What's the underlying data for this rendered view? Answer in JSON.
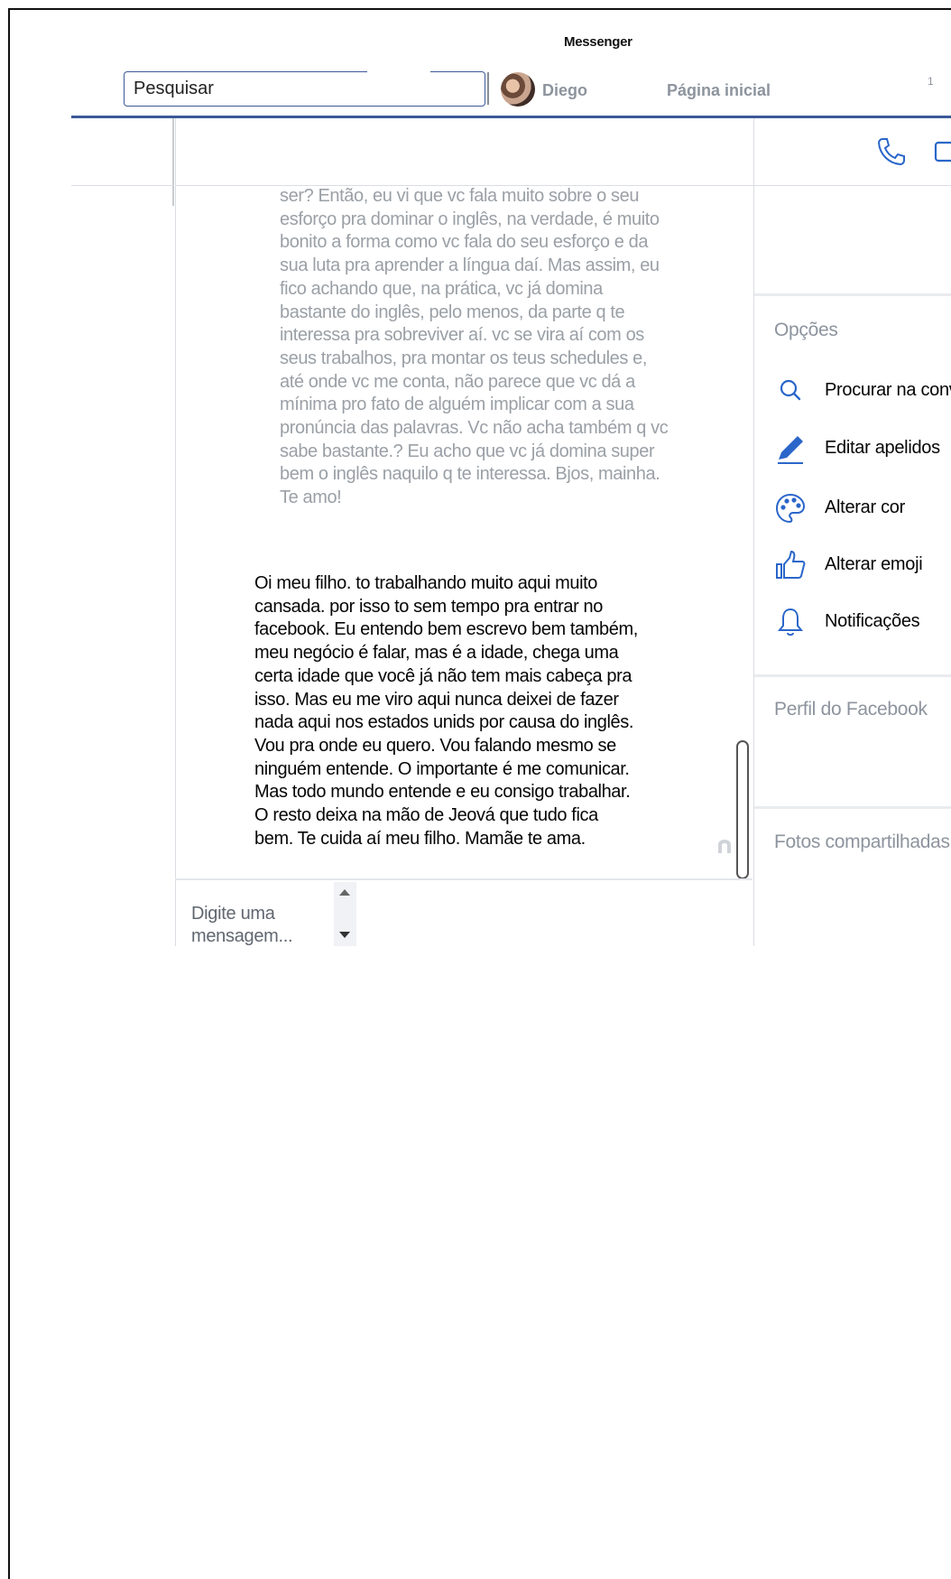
{
  "header": {
    "app_title": "Messenger",
    "search_placeholder": "Pesquisar",
    "user_name": "Diego",
    "home_label": "Página inicial",
    "notification_count": "1"
  },
  "conversation": {
    "incoming_message": "ser? Então, eu vi que vc fala muito sobre o seu\nesforço pra dominar o inglês, na verdade, é muito\nbonito a forma como vc fala do seu esforço e da\nsua luta pra aprender a língua daí. Mas assim, eu\nfico achando que, na prática, vc já domina\nbastante do inglês, pelo menos, da parte q te\ninteressa pra sobreviver aí. vc se vira aí com os\nseus trabalhos, pra montar os teus schedules e,\naté onde vc me conta, não parece que vc dá a\nmínima pro fato de alguém implicar com a sua\npronúncia das palavras. Vc não acha também q vc\nsabe bastante.? Eu acho que vc já domina super\nbem o inglês naquilo q te interessa. Bjos, mainha.\nTe amo!",
    "outgoing_message": "Oi meu filho. to trabalhando muito aqui muito\ncansada. por isso to sem tempo pra entrar no\nfacebook. Eu entendo bem escrevo bem também,\nmeu negócio é falar, mas é a idade, chega uma\ncerta idade que você já não tem mais cabeça pra\nisso. Mas eu me viro aqui nunca deixei de fazer\nnada aqui nos estados unids por causa do inglês.\nVou pra onde eu quero. Vou falando mesmo se\nninguém entende. O importante é me comunicar.\nMas todo mundo entende e eu consigo trabalhar.\nO resto deixa na mão de Jeová que tudo fica\nbem. Te cuida aí meu filho. Mamãe te ama.",
    "composer_placeholder": "Digite uma mensagem..."
  },
  "side_panel": {
    "options_title": "Opções",
    "options": [
      {
        "label": "Procurar na conversa",
        "icon": "search-icon"
      },
      {
        "label": "Editar apelidos",
        "icon": "pencil-icon"
      },
      {
        "label": "Alterar cor",
        "icon": "palette-icon"
      },
      {
        "label": "Alterar emoji",
        "icon": "thumbs-up-icon"
      },
      {
        "label": "Notificações",
        "icon": "bell-icon"
      }
    ],
    "profile_title": "Perfil do Facebook",
    "photos_title": "Fotos compartilhadas"
  },
  "colors": {
    "accent": "#3b5998",
    "icon_blue": "#2a66c9",
    "muted_text": "#8d949e"
  }
}
